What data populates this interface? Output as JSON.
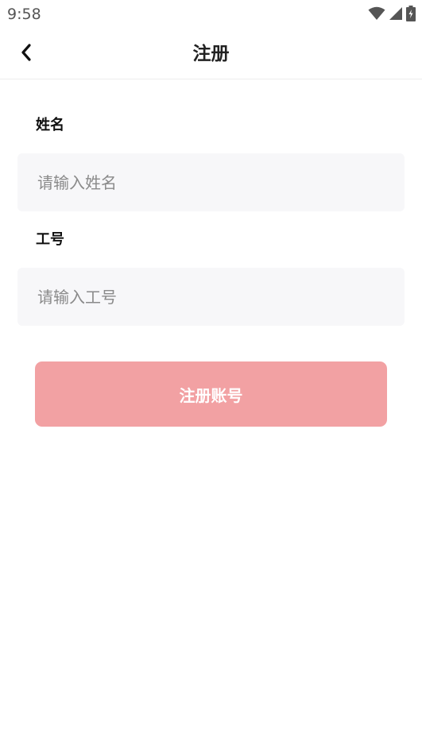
{
  "status_bar": {
    "time": "9:58",
    "icons": [
      "wifi-icon",
      "cell-signal-icon",
      "battery-charging-icon"
    ]
  },
  "header": {
    "back_icon": "chevron-left-icon",
    "title": "注册"
  },
  "form": {
    "name_label": "姓名",
    "name_placeholder": "请输入姓名",
    "name_value": "",
    "id_label": "工号",
    "id_placeholder": "请输入工号",
    "id_value": "",
    "submit_label": "注册账号"
  },
  "colors": {
    "submit_button": "#f2a1a3",
    "input_background": "#f7f7f9",
    "divider": "#ececec"
  }
}
